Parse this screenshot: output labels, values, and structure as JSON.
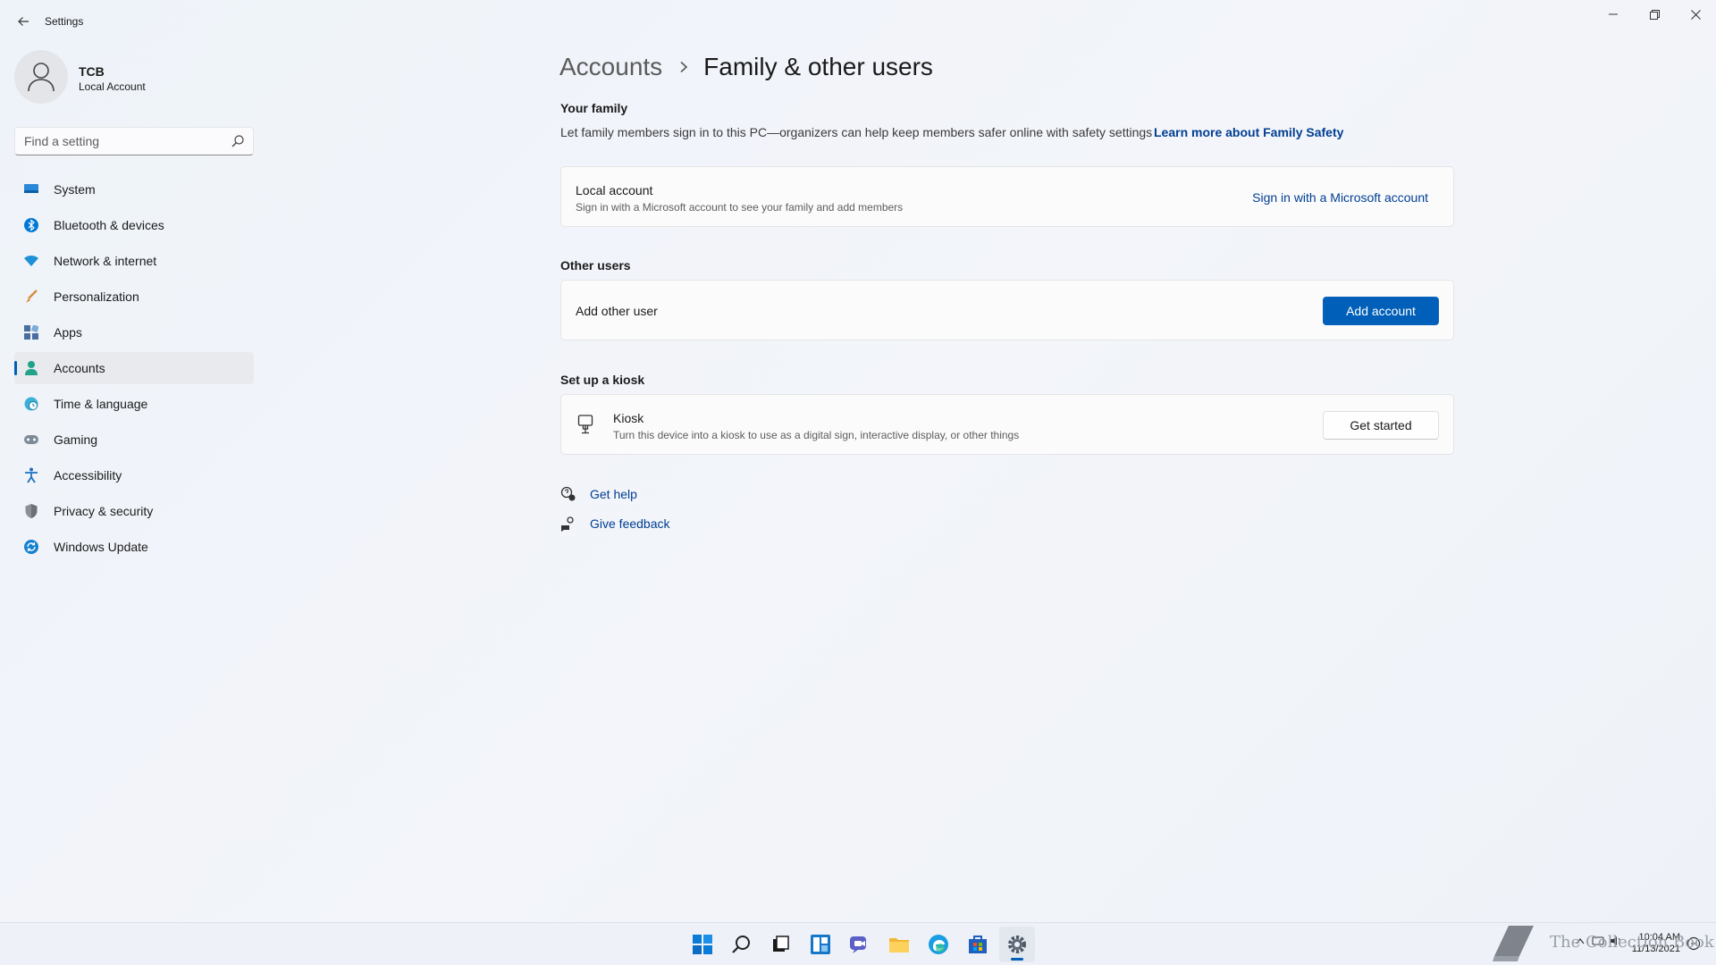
{
  "window": {
    "title": "Settings"
  },
  "profile": {
    "name": "TCB",
    "type": "Local Account"
  },
  "search": {
    "placeholder": "Find a setting"
  },
  "sidebar": {
    "items": [
      {
        "label": "System",
        "icon": "monitor-icon"
      },
      {
        "label": "Bluetooth & devices",
        "icon": "bluetooth-icon"
      },
      {
        "label": "Network & internet",
        "icon": "wifi-icon"
      },
      {
        "label": "Personalization",
        "icon": "brush-icon"
      },
      {
        "label": "Apps",
        "icon": "apps-icon"
      },
      {
        "label": "Accounts",
        "icon": "person-icon",
        "active": true
      },
      {
        "label": "Time & language",
        "icon": "globe-clock-icon"
      },
      {
        "label": "Gaming",
        "icon": "gamepad-icon"
      },
      {
        "label": "Accessibility",
        "icon": "accessibility-icon"
      },
      {
        "label": "Privacy & security",
        "icon": "shield-icon"
      },
      {
        "label": "Windows Update",
        "icon": "update-icon"
      }
    ]
  },
  "breadcrumb": {
    "parent": "Accounts",
    "current": "Family & other users"
  },
  "family": {
    "title": "Your family",
    "description": "Let family members sign in to this PC—organizers can help keep members safer online with safety settings",
    "link": "Learn more about Family Safety",
    "card": {
      "title": "Local account",
      "subtitle": "Sign in with a Microsoft account to see your family and add members",
      "action": "Sign in with a Microsoft account"
    }
  },
  "other_users": {
    "title": "Other users",
    "card": {
      "label": "Add other user",
      "button": "Add account"
    }
  },
  "kiosk": {
    "title": "Set up a kiosk",
    "card": {
      "title": "Kiosk",
      "subtitle": "Turn this device into a kiosk to use as a digital sign, interactive display, or other things",
      "button": "Get started"
    }
  },
  "help": {
    "get_help": "Get help",
    "give_feedback": "Give feedback"
  },
  "taskbar": {
    "apps": [
      "start-icon",
      "search-icon",
      "task-view-icon",
      "widgets-icon",
      "chat-icon",
      "file-explorer-icon",
      "edge-icon",
      "store-icon",
      "settings-icon"
    ],
    "time": "10:04 AM",
    "date": "11/13/2021"
  },
  "watermark": {
    "text": "The Collection Book"
  },
  "colors": {
    "accent": "#005fb8",
    "link": "#003e92",
    "background": "#f0f4f9"
  }
}
